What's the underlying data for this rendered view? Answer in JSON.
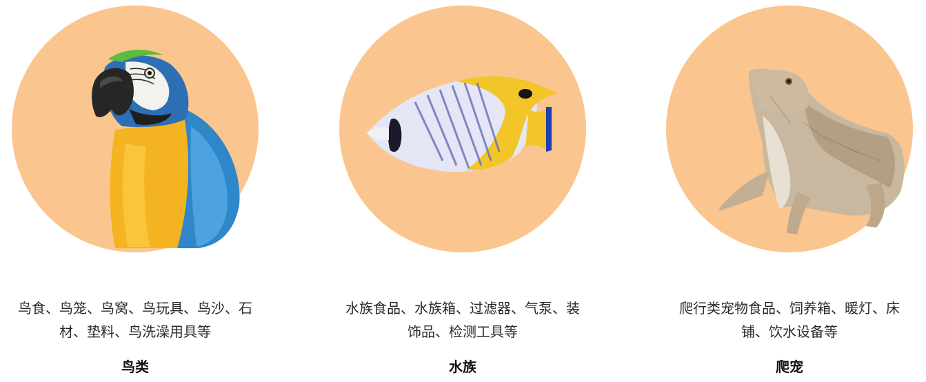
{
  "theme": {
    "circle_color": "#FBC58F"
  },
  "categories": [
    {
      "icon": "parrot-image",
      "description": "鸟食、鸟笼、鸟窝、鸟玩具、鸟沙、石材、垫料、鸟洗澡用具等",
      "title": "鸟类"
    },
    {
      "icon": "fish-image",
      "description": "水族食品、水族箱、过滤器、气泵、装饰品、检测工具等",
      "title": "水族"
    },
    {
      "icon": "lizard-image",
      "description": "爬行类宠物食品、饲养箱、暖灯、床铺、饮水设备等",
      "title": "爬宠"
    }
  ]
}
